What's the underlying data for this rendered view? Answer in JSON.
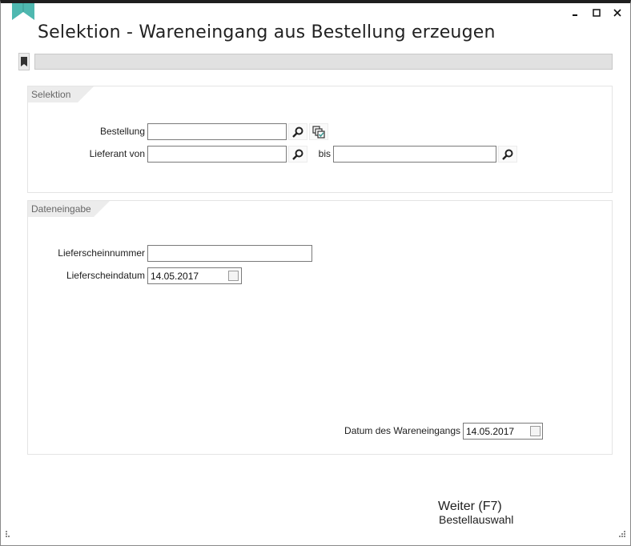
{
  "window": {
    "title": "Selektion - Wareneingang aus Bestellung erzeugen",
    "controls": [
      "minimize-icon",
      "maximize-icon",
      "close-icon"
    ]
  },
  "colors": {
    "accent": "#4fb8b0",
    "window_border": "#1f1f1f",
    "field_border": "#7a7a7a",
    "progress_bg": "#e1e1e1"
  },
  "selection_group": {
    "title": "Selektion",
    "bestellung_label": "Bestellung",
    "bestellung_value": "",
    "lieferant_von_label": "Lieferant von",
    "lieferant_von_value": "",
    "bis_label": "bis",
    "lieferant_bis_value": ""
  },
  "data_group": {
    "title": "Dateneingabe",
    "lieferscheinnummer_label": "Lieferscheinnummer",
    "lieferscheinnummer_value": "",
    "lieferscheindatum_label": "Lieferscheindatum",
    "lieferscheindatum_value": "14.05.2017",
    "datum_wareneingang_label": "Datum des Wareneingangs",
    "datum_wareneingang_value": "14.05.2017"
  },
  "actions": {
    "weiter_label": "Weiter (F7)",
    "weiter_sub": "Bestellauswahl"
  }
}
